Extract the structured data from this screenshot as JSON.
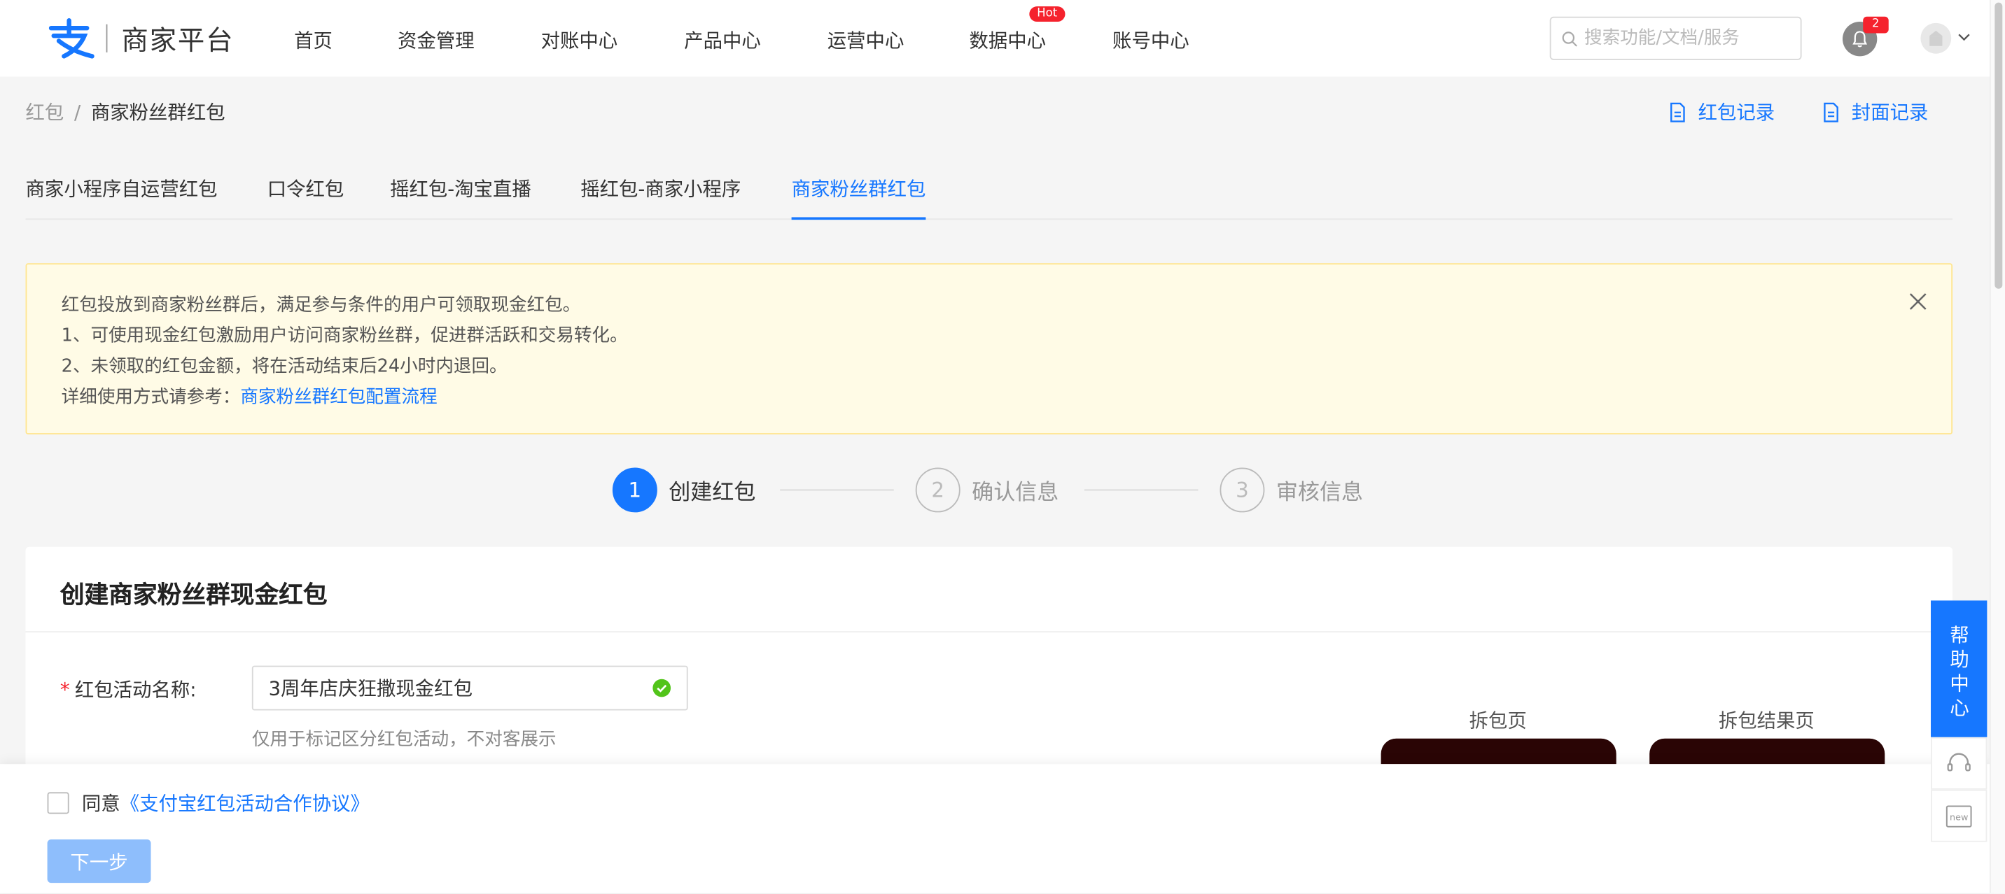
{
  "brand": {
    "platform_name": "商家平台"
  },
  "nav": {
    "items": [
      "首页",
      "资金管理",
      "对账中心",
      "产品中心",
      "运营中心",
      "数据中心",
      "账号中心"
    ],
    "hot_badge": "Hot"
  },
  "search": {
    "placeholder": "搜索功能/文档/服务"
  },
  "notifications": {
    "count": "2"
  },
  "breadcrumb": {
    "parent": "红包",
    "separator": "/",
    "current": "商家粉丝群红包"
  },
  "header_links": {
    "records": "红包记录",
    "cover_records": "封面记录"
  },
  "tabs": [
    {
      "label": "商家小程序自运营红包"
    },
    {
      "label": "口令红包"
    },
    {
      "label": "摇红包-淘宝直播"
    },
    {
      "label": "摇红包-商家小程序"
    },
    {
      "label": "商家粉丝群红包",
      "active": true
    }
  ],
  "alert": {
    "line1": "红包投放到商家粉丝群后，满足参与条件的用户可领取现金红包。",
    "line2": "1、可使用现金红包激励用户访问商家粉丝群，促进群活跃和交易转化。",
    "line3": "2、未领取的红包金额，将在活动结束后24小时内退回。",
    "line4_prefix": "详细使用方式请参考：",
    "line4_link": "商家粉丝群红包配置流程"
  },
  "steps": [
    {
      "num": "1",
      "label": "创建红包",
      "active": true
    },
    {
      "num": "2",
      "label": "确认信息"
    },
    {
      "num": "3",
      "label": "审核信息"
    }
  ],
  "form": {
    "title": "创建商家粉丝群现金红包",
    "required_mark": "*",
    "name_label": "红包活动名称:",
    "name_value": "3周年店庆狂撒现金红包",
    "name_help": "仅用于标记区分红包活动，不对客展示",
    "preview_open": "拆包页",
    "preview_result": "拆包结果页"
  },
  "footer": {
    "agree_prefix": "同意",
    "agree_link": "《支付宝红包活动合作协议》",
    "next_button": "下一步"
  },
  "help": {
    "label": "帮助中心",
    "new_label": "new"
  },
  "colors": {
    "primary": "#1677ff",
    "alert_bg": "#fffbe6",
    "danger": "#f5222d"
  }
}
